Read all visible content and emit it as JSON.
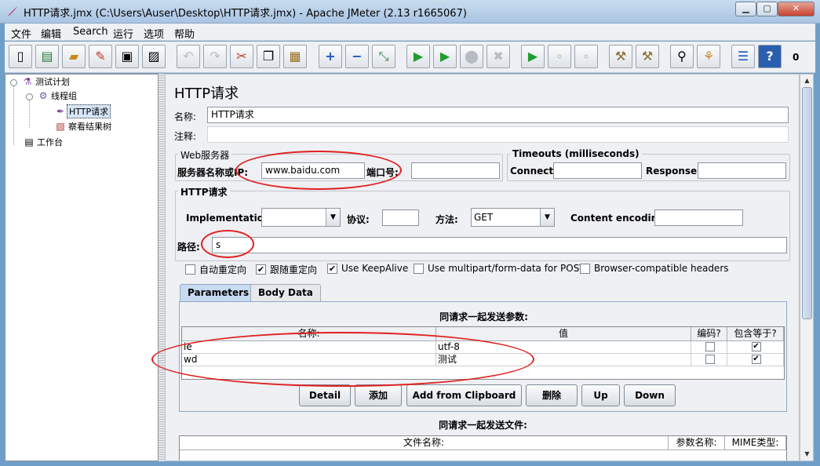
{
  "window": {
    "title": "HTTP请求.jmx (C:\\Users\\Auser\\Desktop\\HTTP请求.jmx) - Apache JMeter (2.13 r1665067)",
    "minimize": "▁",
    "maximize": "▢",
    "close": "✕"
  },
  "menu": {
    "items": [
      "文件",
      "编辑",
      "Search",
      "运行",
      "选项",
      "帮助"
    ]
  },
  "toolbar": {
    "buttons": [
      {
        "icon": "new-icon",
        "glyph": "▯"
      },
      {
        "icon": "templates-icon",
        "glyph": "▤"
      },
      {
        "icon": "open-icon",
        "glyph": "▰"
      },
      {
        "icon": "close-file-icon",
        "glyph": "✎"
      },
      {
        "icon": "save-icon",
        "glyph": "▣"
      },
      {
        "icon": "save-as-icon",
        "glyph": "▨"
      },
      {
        "icon": "undo-icon",
        "glyph": "↶"
      },
      {
        "icon": "redo-icon",
        "glyph": "↷"
      },
      {
        "icon": "cut-icon",
        "glyph": "✂"
      },
      {
        "icon": "copy-icon",
        "glyph": "❐"
      },
      {
        "icon": "paste-icon",
        "glyph": "▦"
      },
      {
        "icon": "expand-icon",
        "glyph": "+"
      },
      {
        "icon": "collapse-icon",
        "glyph": "−"
      },
      {
        "icon": "toggle-icon",
        "glyph": "⤡"
      },
      {
        "icon": "start-icon",
        "glyph": "▶"
      },
      {
        "icon": "start-no-timers-icon",
        "glyph": "▶"
      },
      {
        "icon": "stop-icon",
        "glyph": "⬤"
      },
      {
        "icon": "shutdown-icon",
        "glyph": "✖"
      },
      {
        "icon": "remote-start-icon",
        "glyph": "▶"
      },
      {
        "icon": "remote-stop-icon",
        "glyph": "∘"
      },
      {
        "icon": "remote-shutdown-icon",
        "glyph": "∘"
      },
      {
        "icon": "clear-icon",
        "glyph": "⚒"
      },
      {
        "icon": "clear-all-icon",
        "glyph": "⚒"
      },
      {
        "icon": "search-icon",
        "glyph": "⚲"
      },
      {
        "icon": "reset-search-icon",
        "glyph": "⚘"
      },
      {
        "icon": "function-helper-icon",
        "glyph": "☰"
      },
      {
        "icon": "help-icon",
        "glyph": "?"
      }
    ],
    "error_count": "0",
    "colors": {
      "green": "#1f9d2f",
      "blue": "#1f55c0",
      "red": "#c0392b"
    }
  },
  "tree": {
    "nodes": [
      {
        "label": "测试计划",
        "icon": "test-plan-icon",
        "glyph": "⚗"
      },
      {
        "label": "线程组",
        "icon": "thread-group-icon",
        "glyph": "⚙"
      },
      {
        "label": "HTTP请求",
        "icon": "http-sampler-icon",
        "glyph": "✒"
      },
      {
        "label": "察看结果树",
        "icon": "results-tree-icon",
        "glyph": "▧"
      },
      {
        "label": "工作台",
        "icon": "workbench-icon",
        "glyph": "▤"
      }
    ]
  },
  "panel": {
    "title": "HTTP请求",
    "name_label": "名称:",
    "name_value": "HTTP请求",
    "comments_label": "注释:",
    "comments_value": "",
    "web_server": {
      "legend": "Web服务器",
      "server_label": "服务器名称或IP:",
      "server_value": "www.baidu.com",
      "port_label": "端口号:",
      "port_value": ""
    },
    "timeouts": {
      "legend": "Timeouts (milliseconds)",
      "connect_label": "Connect:",
      "connect_value": "",
      "response_label": "Response:",
      "response_value": ""
    },
    "http_request": {
      "legend": "HTTP请求",
      "implementation_label": "Implementation:",
      "implementation_value": "",
      "protocol_label": "协议:",
      "protocol_value": "",
      "method_label": "方法:",
      "method_value": "GET",
      "encoding_label": "Content encoding:",
      "encoding_value": "",
      "path_label": "路径:",
      "path_value": "s"
    },
    "checkboxes": [
      {
        "label": "自动重定向",
        "checked": false
      },
      {
        "label": "跟随重定向",
        "checked": true
      },
      {
        "label": "Use KeepAlive",
        "checked": true
      },
      {
        "label": "Use multipart/form-data for POST",
        "checked": false
      },
      {
        "label": "Browser-compatible headers",
        "checked": false
      }
    ],
    "tabs": [
      "Parameters",
      "Body Data"
    ],
    "params": {
      "caption": "同请求一起发送参数:",
      "columns": [
        "名称:",
        "值",
        "编码?",
        "包含等于?"
      ],
      "rows": [
        {
          "name": "ie",
          "value": "utf-8",
          "encode": false,
          "include_equals": true
        },
        {
          "name": "wd",
          "value": "测试",
          "encode": false,
          "include_equals": true
        }
      ]
    },
    "buttons": [
      "Detail",
      "添加",
      "Add from Clipboard",
      "删除",
      "Up",
      "Down"
    ],
    "files": {
      "caption": "同请求一起发送文件:",
      "columns": [
        "文件名称:",
        "参数名称:",
        "MIME类型:"
      ]
    },
    "check_glyph": "✔",
    "scroll_up": "▲",
    "scroll_down": "▼",
    "combo_arrow": "▼"
  }
}
